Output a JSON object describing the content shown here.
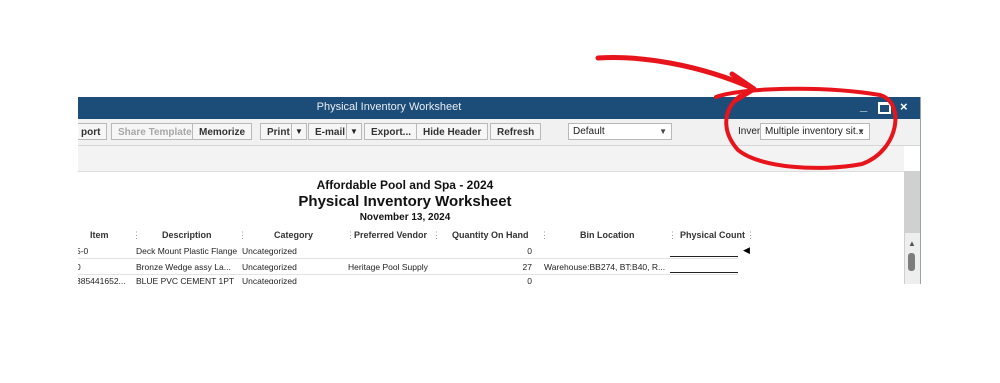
{
  "window": {
    "title": "Physical Inventory Worksheet"
  },
  "toolbar": {
    "export_template_label": "port",
    "share_template_label": "Share Template",
    "memorize_label": "Memorize",
    "print_label": "Print",
    "email_label": "E-mail",
    "export_label": "Export...",
    "hide_header_label": "Hide Header",
    "refresh_label": "Refresh",
    "default_select": "Default",
    "inventory_label": "Inven",
    "inventory_select": "Multiple inventory sit..."
  },
  "report": {
    "company": "Affordable Pool and Spa - 2024",
    "title": "Physical Inventory Worksheet",
    "date": "November 13, 2024",
    "columns": [
      "Item",
      "Description",
      "Category",
      "Preferred Vendor",
      "Quantity On Hand",
      "Bin Location",
      "Physical Count"
    ],
    "rows": [
      {
        "item": "5-0",
        "description": "Deck Mount Plastic Flange",
        "category": "Uncategorized",
        "vendor": "",
        "qty": "0",
        "bin": ""
      },
      {
        "item": "0",
        "description": "Bronze Wedge assy La...",
        "category": "Uncategorized",
        "vendor": "Heritage Pool Supply",
        "qty": "27",
        "bin": "Warehouse:BB274, BT:B40, R..."
      },
      {
        "item": "385441652...",
        "description": "BLUE PVC CEMENT 1PT",
        "category": "Uncategorized",
        "vendor": "",
        "qty": "0",
        "bin": ""
      }
    ]
  },
  "colors": {
    "titlebar": "#1c4d78",
    "annotation": "#e8141c"
  }
}
